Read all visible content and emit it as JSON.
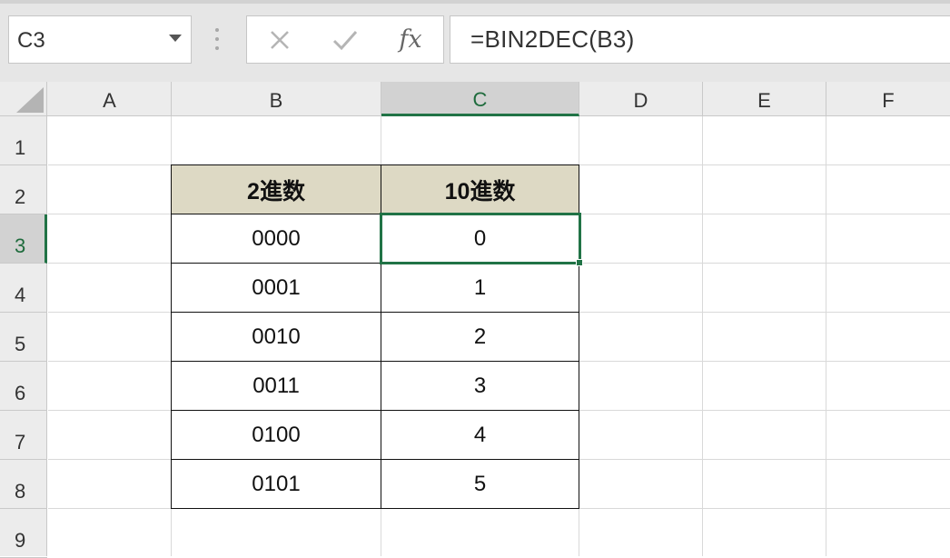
{
  "formula_bar": {
    "name_box": "C3",
    "cancel_icon": "close-icon",
    "enter_icon": "check-icon",
    "function_label": "fx",
    "formula": "=BIN2DEC(B3)"
  },
  "columns": [
    "A",
    "B",
    "C",
    "D",
    "E",
    "F"
  ],
  "active_column": "C",
  "rows": [
    "1",
    "2",
    "3",
    "4",
    "5",
    "6",
    "7",
    "8",
    "9"
  ],
  "active_row": "3",
  "selected_cell": "C3",
  "table": {
    "headers": [
      "2進数",
      "10進数"
    ],
    "rows": [
      [
        "0000",
        "0"
      ],
      [
        "0001",
        "1"
      ],
      [
        "0010",
        "2"
      ],
      [
        "0011",
        "3"
      ],
      [
        "0100",
        "4"
      ],
      [
        "0101",
        "5"
      ]
    ],
    "header_fill": "#ddd9c4"
  },
  "colors": {
    "accent": "#217346",
    "header_bg": "#ececec",
    "gridline": "#d9d9d9"
  }
}
